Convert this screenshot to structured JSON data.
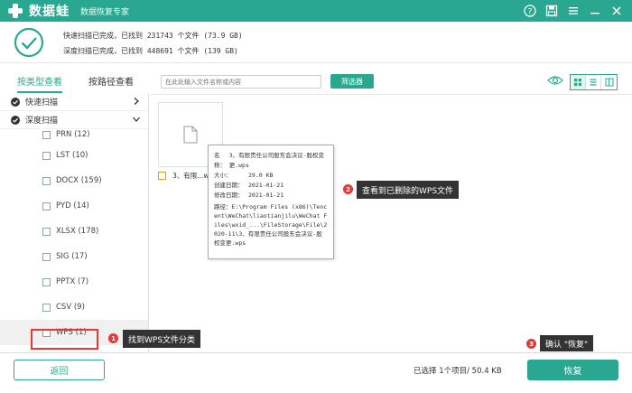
{
  "app": {
    "name": "数据蛙",
    "subtitle": "数据恢复专家"
  },
  "status": {
    "quick_scan": "快速扫描已完成，已找到 231743 个文件 (73.9 GB)",
    "deep_scan": "深度扫描已完成，已找到 448691 个文件 (139 GB)"
  },
  "tabs": [
    "按类型查看",
    "按路径查看"
  ],
  "scan_sections": [
    "快速扫描",
    "深度扫描"
  ],
  "categories": [
    "PRN (12)",
    "LST (10)",
    "DOCX (159)",
    "PYD (14)",
    "XLSX (178)",
    "SIG (17)",
    "PPTX (7)",
    "CSV (9)",
    "WPS (1)"
  ],
  "search": {
    "placeholder": "在此处输入文件名称或内容"
  },
  "filter_label": "筛选器",
  "file": {
    "name": "3、有限...wps"
  },
  "tooltip": {
    "name_key": "名称：",
    "name_val": "3、有限责任公司股东会决议-股权变更.wps",
    "size_key": "大小：",
    "size_val": "29.0 KB",
    "created_key": "创建日期：",
    "created_val": "2021-01-21",
    "modified_key": "修改日期：",
    "modified_val": "2021-01-21",
    "path_key": "路径：",
    "path_val": "E:\\Program Files (x86)\\Tencent\\WeChat\\liaotianjilu\\WeChat Files\\wxid_...\\FileStorage\\File\\2020-11\\3、有限责任公司股东会决议-股权变更.wps"
  },
  "callouts": {
    "one": "找到WPS文件分类",
    "two": "查看到已删除的WPS文件",
    "three": "确认 \"恢复\""
  },
  "badges": {
    "one": "1",
    "two": "2",
    "three": "3"
  },
  "footer": {
    "back": "返回",
    "selection": "已选择 1个项目/ 50.4 KB",
    "recover": "恢复"
  },
  "colors": {
    "accent": "#2aa790",
    "highlight": "#e53935"
  }
}
